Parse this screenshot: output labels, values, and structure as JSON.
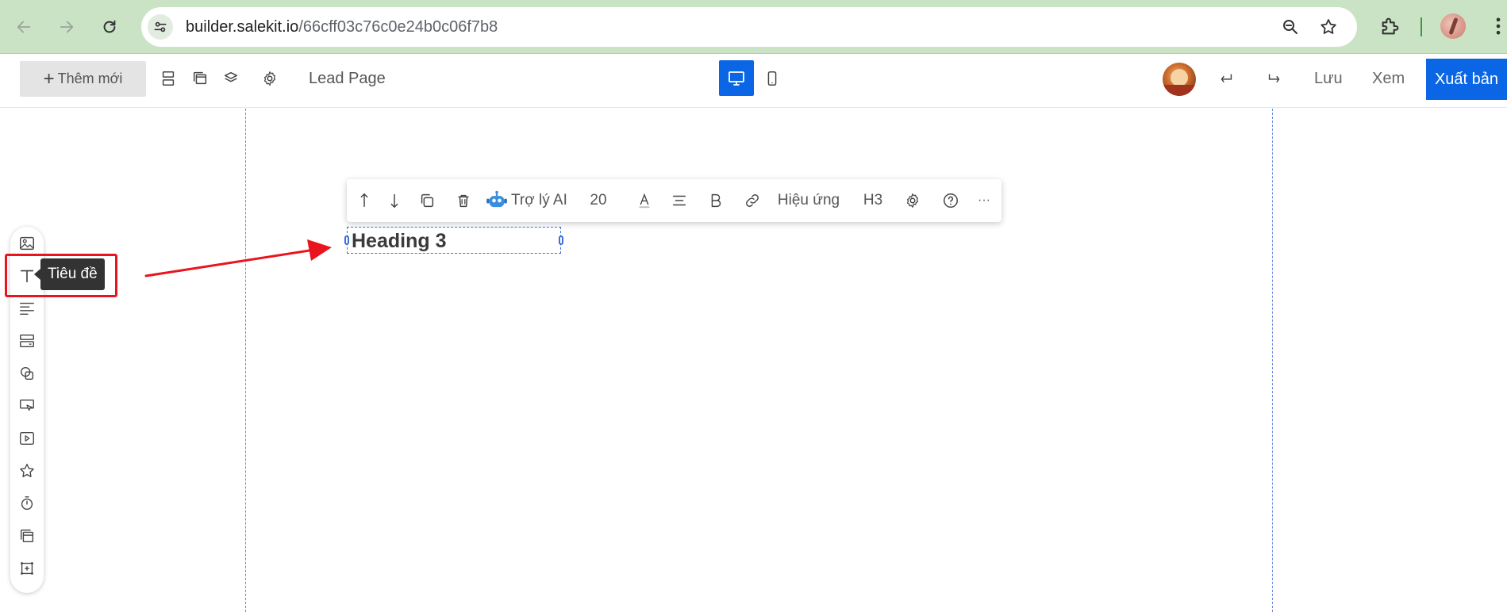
{
  "browser": {
    "url_host": "builder.salekit.io",
    "url_path": "/66cff03c76c0e24b0c06f7b8"
  },
  "toolbar": {
    "add_new_label": "Thêm mới",
    "page_name": "Lead Page",
    "save_label": "Lưu",
    "preview_label": "Xem",
    "publish_label": "Xuất bản"
  },
  "text_toolbar": {
    "ai_label": "Trợ lý AI",
    "font_size": "20",
    "effects_label": "Hiệu ứng",
    "heading_level": "H3",
    "more_label": "···"
  },
  "canvas": {
    "heading_text": "Heading 3"
  },
  "widget_panel": {
    "tooltip": "Tiêu đề"
  },
  "colors": {
    "accent": "#0a66e4",
    "annotation": "#e8141e",
    "chrome": "#cbe3c5"
  }
}
